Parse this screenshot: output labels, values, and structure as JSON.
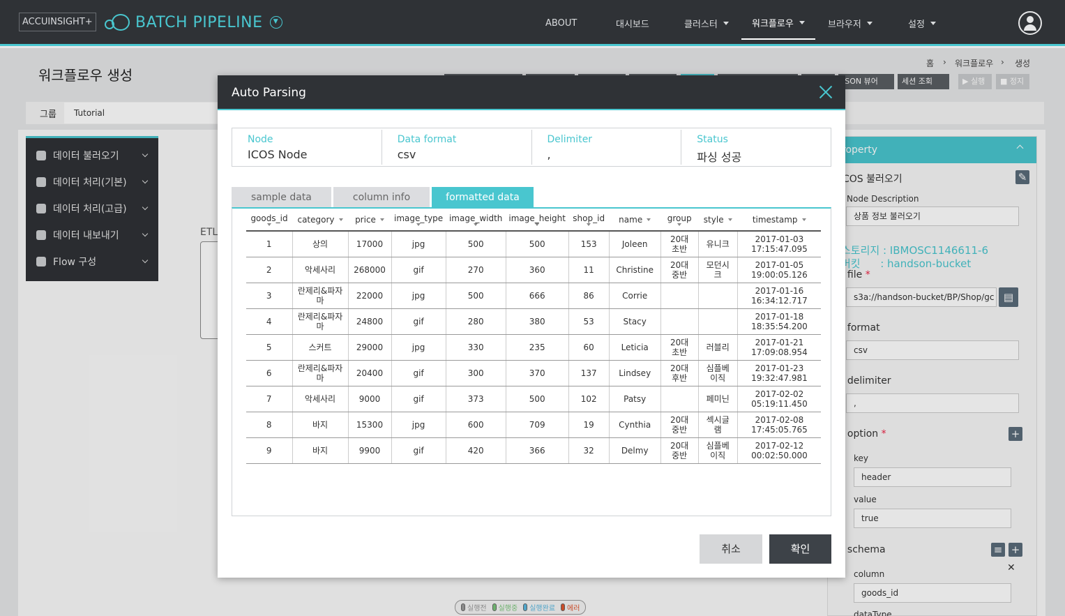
{
  "header": {
    "logo": "ACCUINSIGHT+",
    "brand": "BATCH PIPELINE",
    "nav": [
      {
        "label": "ABOUT",
        "dropdown": false
      },
      {
        "label": "대시보드",
        "dropdown": false
      },
      {
        "label": "클러스터",
        "dropdown": true
      },
      {
        "label": "워크플로우",
        "dropdown": true,
        "active": true
      },
      {
        "label": "브라우저",
        "dropdown": true
      },
      {
        "label": "설정",
        "dropdown": true
      }
    ]
  },
  "page": {
    "title": "워크플로우 생성",
    "breadcrumb": [
      "홈",
      "워크플로우",
      "생성"
    ],
    "group_label": "그룹",
    "group_value": "Tutorial",
    "toolbar": {
      "json_viewer": "JSON 뷰어",
      "session": "세션 조회",
      "run": "실행",
      "stop": "정지"
    }
  },
  "sidebar": {
    "items": [
      "데이터 불러오기",
      "데이터 처리(기본)",
      "데이터 처리(고급)",
      "데이터 내보내기",
      "Flow 구성"
    ]
  },
  "canvas": {
    "etl_label": "ETL"
  },
  "property": {
    "header": "roperty",
    "node_title": "COS 불러오기",
    "node_desc_label": "Node Description",
    "node_desc": "상품 정보 불러오기",
    "storage_line": "스토리지 : IBMOSC1146611-6",
    "bucket_line": "버킷      : handson-bucket",
    "file_label": ". file",
    "file_value": "s3a://handson-bucket/BP/Shop/gc",
    "format_label": ". format",
    "format_value": "csv",
    "delimiter_label": ". delimiter",
    "delimiter_value": ",",
    "option_label": ". option",
    "key_label": "key",
    "key_value": "header",
    "value_label": "value",
    "value_value": "true",
    "schema_label": ". schema",
    "column_label": "column",
    "column_value": "goods_id",
    "datatype_label": "dataType"
  },
  "legend": [
    "실행전",
    "실행중",
    "실행완료",
    "에러"
  ],
  "legend_colors": [
    "#9a9a9a",
    "#7bc67b",
    "#5bb8e0",
    "#e0552e"
  ],
  "modal": {
    "title": "Auto Parsing",
    "info": [
      {
        "label": "Node",
        "value": "ICOS Node"
      },
      {
        "label": "Data format",
        "value": "csv"
      },
      {
        "label": "Delimiter",
        "value": ","
      },
      {
        "label": "Status",
        "value": "파싱 성공"
      }
    ],
    "tabs": [
      "sample data",
      "column info",
      "formatted data"
    ],
    "columns": [
      "goods_id",
      "category",
      "price",
      "image_type",
      "image_width",
      "image_height",
      "shop_id",
      "name",
      "group",
      "style",
      "timestamp"
    ],
    "rows": [
      [
        "1",
        "상의",
        "17000",
        "jpg",
        "500",
        "500",
        "153",
        "Joleen",
        "20대 초반",
        "유니크",
        "2017-01-03 17:15:47.095"
      ],
      [
        "2",
        "악세사리",
        "268000",
        "gif",
        "270",
        "360",
        "11",
        "Christine",
        "20대 중반",
        "모던시크",
        "2017-01-05 19:00:05.126"
      ],
      [
        "3",
        "란제리&파자마",
        "22000",
        "jpg",
        "500",
        "666",
        "86",
        "Corrie",
        "",
        "",
        "2017-01-16 16:34:12.717"
      ],
      [
        "4",
        "란제리&파자마",
        "24800",
        "gif",
        "280",
        "380",
        "53",
        "Stacy",
        "",
        "",
        "2017-01-18 18:35:54.200"
      ],
      [
        "5",
        "스커트",
        "29000",
        "jpg",
        "330",
        "235",
        "60",
        "Leticia",
        "20대 초반",
        "러블리",
        "2017-01-21 17:09:08.954"
      ],
      [
        "6",
        "란제리&파자마",
        "20400",
        "gif",
        "300",
        "370",
        "137",
        "Lindsey",
        "20대 후반",
        "심플베이직",
        "2017-01-23 19:32:47.981"
      ],
      [
        "7",
        "악세사리",
        "9000",
        "gif",
        "373",
        "500",
        "102",
        "Patsy",
        "",
        "페미닌",
        "2017-02-02 05:19:11.450"
      ],
      [
        "8",
        "바지",
        "15300",
        "jpg",
        "600",
        "709",
        "19",
        "Cynthia",
        "20대 중반",
        "섹시글램",
        "2017-02-08 17:45:05.765"
      ],
      [
        "9",
        "바지",
        "9900",
        "gif",
        "420",
        "366",
        "32",
        "Delmy",
        "20대 중반",
        "심플베이직",
        "2017-02-12 00:02:50.000"
      ]
    ],
    "cancel": "취소",
    "confirm": "확인"
  }
}
